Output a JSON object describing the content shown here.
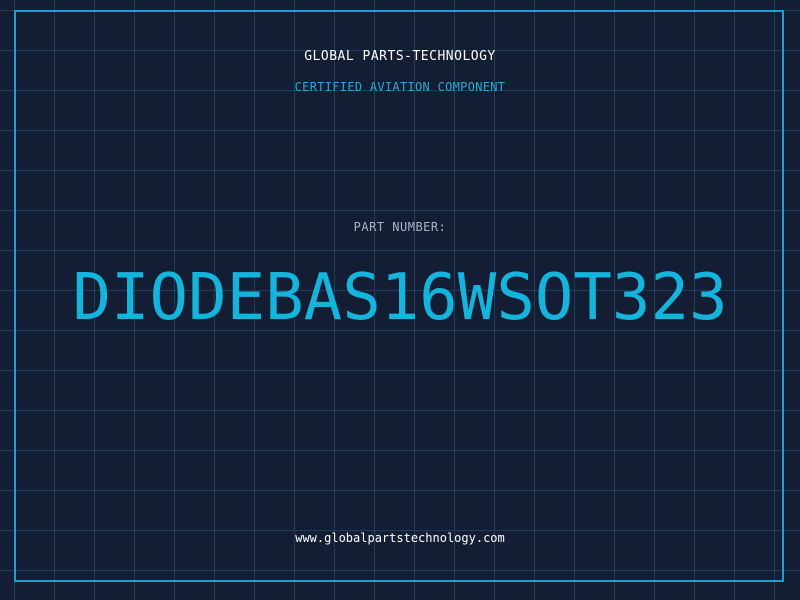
{
  "header": {
    "company": "GLOBAL PARTS-TECHNOLOGY",
    "subtitle": "CERTIFIED AVIATION COMPONENT"
  },
  "part": {
    "label": "PART NUMBER:",
    "number": "DIODEBAS16WSOT323"
  },
  "footer": {
    "website": "www.globalpartstechnology.com"
  },
  "colors": {
    "background": "#131d33",
    "accent": "#14b4dc",
    "border": "#1f9fcf",
    "grid": "#225a78",
    "text": "#ffffff"
  }
}
